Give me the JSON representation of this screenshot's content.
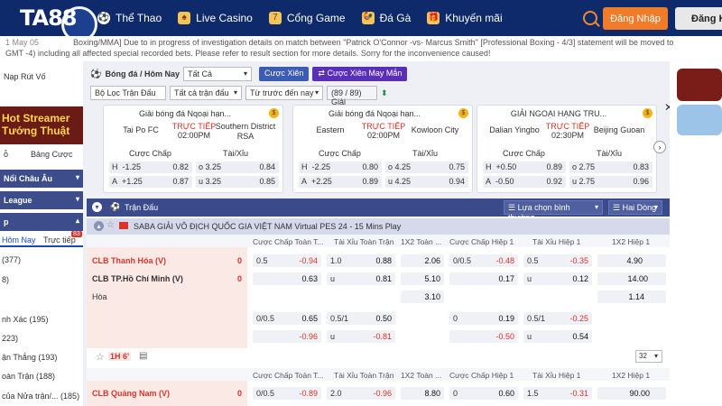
{
  "brand": {
    "name": "TA88"
  },
  "nav": [
    {
      "label": "Thể Thao"
    },
    {
      "label": "Live Casino"
    },
    {
      "label": "Cổng Game"
    },
    {
      "label": "Đá Gà"
    },
    {
      "label": "Khuyến mãi"
    }
  ],
  "auth": {
    "login": "Đăng Nhập",
    "register": "Đăng K"
  },
  "marquee": {
    "date": "1 May 05",
    "line1": "Boxing/MMA] Due to in progress of investigation details on match between \"Patrick O'Connor -vs- Marcus Smith\" [Professional Boxing - 4/3] statement will be moved to",
    "line2": "GMT -4) including all affected special recorded bets. Please refer to result section for more details. Sorry for the inconvenience caused!"
  },
  "sidebar": {
    "deposit": "Nạp Rút Vố",
    "banner": "Hot Streamer\nTướng Thuật",
    "tab_selected": "ỗ",
    "tab_other": "Bảng Cược",
    "groups": [
      "Nổi Châu Âu",
      "League",
      "p"
    ],
    "sub_tabs": {
      "today": "Hôm Nay",
      "live": "Trực tiếp",
      "live_count": "83"
    },
    "items": [
      {
        "label": "(377)"
      },
      {
        "label": "8)"
      },
      {
        "label": "nh Xác (195)"
      },
      {
        "label": "223)"
      },
      {
        "label": "ận Thắng (193)"
      },
      {
        "label": "oàn Trận (188)"
      },
      {
        "label": "của Nửa trận/... (185)"
      }
    ]
  },
  "filters": {
    "sport_title": "Bóng đá / Hôm Nay",
    "all": "Tất Cả",
    "parlay": "Cược Xiên",
    "lucky_parlay": "Cược Xiên May Mắn",
    "league_filter": "Bộ Lọc Trận Đấu",
    "all_matches": "Tất cả trận đấu",
    "sort": "Từ trước đến nay",
    "count": "(89 / 89) Giải"
  },
  "cards": [
    {
      "title": "Giải bóng đá Nqoại hạn...",
      "live": "TRỰC TIẾP",
      "time": "02:00PM",
      "home": "Tai Po FC",
      "away": "Southern District RSA",
      "ah_label": "Cược Chấp",
      "ou_label": "Tài/Xỉu",
      "rows": [
        [
          "H",
          "-1.25",
          "0.82",
          "o",
          "3.25",
          "0.84"
        ],
        [
          "A",
          "+1.25",
          "0.87",
          "u",
          "3.25",
          "0.85"
        ]
      ]
    },
    {
      "title": "Giải bóng đá Nqoại hạn...",
      "live": "TRỰC TIẾP",
      "time": "02:00PM",
      "home": "Eastern",
      "away": "Kowloon City",
      "ah_label": "Cược Chấp",
      "ou_label": "Tài/Xỉu",
      "rows": [
        [
          "H",
          "-2.25",
          "0.80",
          "o",
          "4.25",
          "0.75"
        ],
        [
          "A",
          "+2.25",
          "0.89",
          "u",
          "4.25",
          "0.94"
        ]
      ]
    },
    {
      "title": "GIẢI NGOẠI HẠNG TRU...",
      "live": "TRỰC TIẾP",
      "time": "02:30PM",
      "home": "Dalian Yingbo",
      "away": "Beijing Guoan",
      "ah_label": "Cược Chấp",
      "ou_label": "Tài/Xỉu",
      "rows": [
        [
          "H",
          "+0.50",
          "0.89",
          "o",
          "2.75",
          "0.83"
        ],
        [
          "A",
          "-0.50",
          "0.92",
          "u",
          "2.75",
          "0.96"
        ]
      ]
    }
  ],
  "table": {
    "header": "Trận Đấu",
    "sort_select": "Lựa chọn bình thường",
    "lines_select": "Hai Dòng",
    "league": "SABA GIẢI VÔ ĐỊCH QUỐC GIA VIỆT NAM Virtual PES 24 - 15 Mins Play",
    "columns": [
      "Cược Chấp Toàn T...",
      "Tài Xỉu Toàn Trận",
      "1X2 Toàn ...",
      "Cược Chấp Hiệp 1",
      "Tài Xỉu Hiệp 1",
      "1X2 Hiệp 1"
    ],
    "match1": {
      "home": "CLB Thanh Hóa (V)",
      "home_score": "0",
      "away": "CLB TP.Hồ Chí Minh (V)",
      "away_score": "0",
      "draw": "Hòa",
      "r1": [
        "0.5",
        "-0.94",
        "1.0",
        "0.88",
        "2.06",
        "0/0.5",
        "-0.48",
        "0.5",
        "-0.35",
        "4.90"
      ],
      "r2": [
        "",
        "0.63",
        "u",
        "0.81",
        "5.10",
        "",
        "0.17",
        "u",
        "0.12",
        "14.00"
      ],
      "r3": [
        "3.10",
        "1.14"
      ],
      "r4": [
        "0/0.5",
        "0.65",
        "0.5/1",
        "0.50",
        "0",
        "0.19",
        "0.5/1",
        "-0.25"
      ],
      "r5": [
        "",
        "-0.96",
        "u",
        "-0.81",
        "",
        "-0.50",
        "u",
        "0.54"
      ]
    },
    "live_badge": "1H 6'",
    "more_count": "32",
    "match2": {
      "home": "CLB Quảng Nam (V)",
      "home_score": "0",
      "r1": [
        "0/0.5",
        "-0.89",
        "2.0",
        "-0.96",
        "8.80",
        "0",
        "0.60",
        "1.5",
        "-0.31",
        "90.00"
      ]
    }
  },
  "colors": {
    "topbar": "#0e2a6b",
    "accent": "#f07c2a",
    "negative": "#d9342b"
  }
}
